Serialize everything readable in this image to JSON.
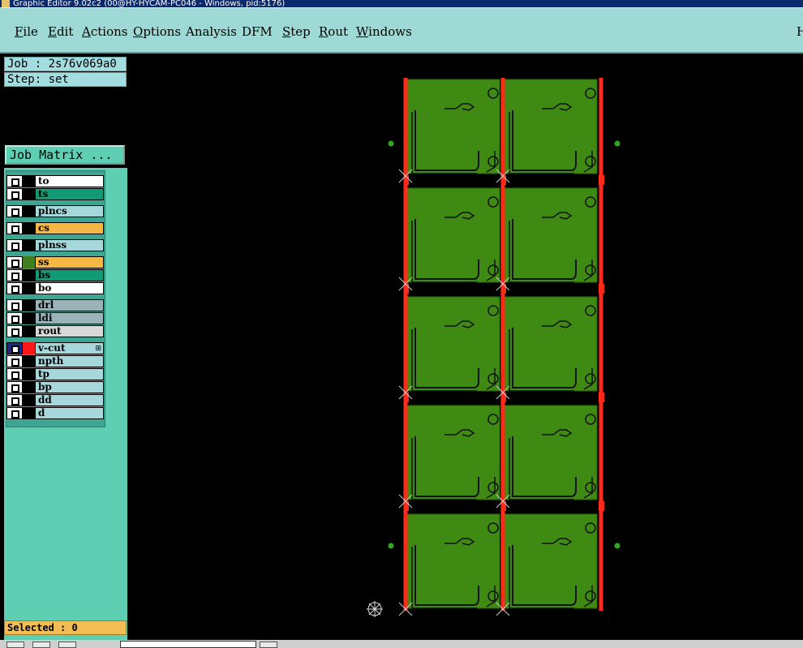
{
  "window": {
    "title": "Graphic Editor 9.02c2 (00@HY-HYCAM-PC046 - Windows, pid:5176)"
  },
  "menu": {
    "items": [
      {
        "label": "File",
        "mnemonic": "F"
      },
      {
        "label": "Edit",
        "mnemonic": "E"
      },
      {
        "label": "Actions",
        "mnemonic": "A"
      },
      {
        "label": "Options",
        "mnemonic": "O"
      },
      {
        "label": "Analysis",
        "mnemonic": ""
      },
      {
        "label": "DFM",
        "mnemonic": ""
      },
      {
        "label": "Step",
        "mnemonic": "S"
      },
      {
        "label": "Rout",
        "mnemonic": "R"
      },
      {
        "label": "Windows",
        "mnemonic": "W"
      }
    ],
    "help_label": "H"
  },
  "job": {
    "label": "Job : 2s76v069a0",
    "step": "Step: set"
  },
  "job_matrix_button": "Job Matrix ...",
  "layers": [
    {
      "name": "to",
      "color": "#ffffff",
      "swatch": "#000000",
      "checked": false
    },
    {
      "name": "ts",
      "color": "#119a74",
      "swatch": "#000000",
      "checked": false
    },
    {
      "name": "plncs",
      "color": "#a6d8db",
      "swatch": "#000000",
      "checked": false
    },
    {
      "name": "cs",
      "color": "#f5b844",
      "swatch": "#000000",
      "checked": false
    },
    {
      "name": "plnss",
      "color": "#a6d8db",
      "swatch": "#000000",
      "checked": false
    },
    {
      "name": "ss",
      "color": "#f5b844",
      "swatch": "#3f7f1f",
      "checked": false
    },
    {
      "name": "bs",
      "color": "#119a74",
      "swatch": "#000000",
      "checked": false
    },
    {
      "name": "bo",
      "color": "#ffffff",
      "swatch": "#000000",
      "checked": false
    },
    {
      "name": "drl",
      "color": "#9ab3b8",
      "swatch": "#000000",
      "checked": false
    },
    {
      "name": "ldi",
      "color": "#9ab3b8",
      "swatch": "#000000",
      "checked": false
    },
    {
      "name": "rout",
      "color": "#d8d8d8",
      "swatch": "#000000",
      "checked": false
    },
    {
      "name": "v-cut",
      "color": "#a6d8db",
      "swatch": "#ff1a1a",
      "checked": true
    },
    {
      "name": "npth",
      "color": "#a6d8db",
      "swatch": "#000000",
      "checked": false
    },
    {
      "name": "tp",
      "color": "#a6d8db",
      "swatch": "#000000",
      "checked": false
    },
    {
      "name": "bp",
      "color": "#a6d8db",
      "swatch": "#000000",
      "checked": false
    },
    {
      "name": "dd",
      "color": "#a6d8db",
      "swatch": "#000000",
      "checked": false
    },
    {
      "name": "d",
      "color": "#a6d8db",
      "swatch": "#000000",
      "checked": false
    }
  ],
  "selected": "Selected : 0",
  "panel_layout": {
    "rows": 5,
    "columns": 2
  },
  "colors": {
    "board": "#3f8a12",
    "vcut": "#ff2a1a",
    "fiducial": "#2fa81f",
    "outline": "#111111"
  }
}
